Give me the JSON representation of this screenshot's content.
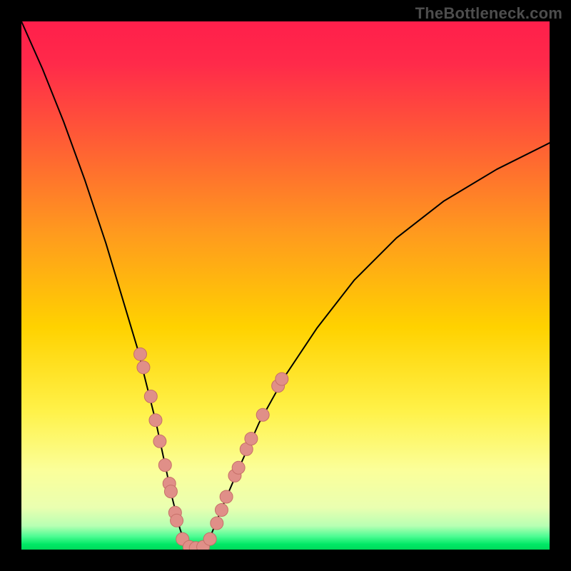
{
  "watermark": "TheBottleneck.com",
  "colors": {
    "bg": "#000000",
    "gradient_top": "#ff1f4b",
    "gradient_mid": "#ffd200",
    "gradient_low": "#fff7a3",
    "gradient_green": "#00e865",
    "curve": "#000000",
    "dot_fill": "#e08f88",
    "dot_stroke": "#c66f68"
  },
  "chart_data": {
    "type": "line",
    "title": "",
    "xlabel": "",
    "ylabel": "",
    "xlim": [
      0,
      100
    ],
    "ylim": [
      0,
      100
    ],
    "series": [
      {
        "name": "bottleneck-curve",
        "x": [
          0,
          4,
          8,
          12,
          16,
          19,
          22,
          24,
          25.5,
          27,
          28.5,
          30,
          31,
          32,
          33,
          34,
          35,
          36,
          38,
          41,
          45,
          50,
          56,
          63,
          71,
          80,
          90,
          100
        ],
        "y": [
          100,
          91,
          81,
          70,
          58,
          48,
          38,
          30,
          24,
          17,
          10,
          4,
          1,
          0,
          0,
          0,
          1,
          3,
          8,
          15,
          24,
          33,
          42,
          51,
          59,
          66,
          72,
          77
        ]
      }
    ],
    "markers": [
      {
        "x": 22.5,
        "y": 37
      },
      {
        "x": 23.1,
        "y": 34.5
      },
      {
        "x": 24.5,
        "y": 29
      },
      {
        "x": 25.4,
        "y": 24.5
      },
      {
        "x": 26.2,
        "y": 20.5
      },
      {
        "x": 27.2,
        "y": 16
      },
      {
        "x": 28.0,
        "y": 12.5
      },
      {
        "x": 28.3,
        "y": 11
      },
      {
        "x": 29.1,
        "y": 7
      },
      {
        "x": 29.4,
        "y": 5.5
      },
      {
        "x": 30.5,
        "y": 2
      },
      {
        "x": 31.8,
        "y": 0.5
      },
      {
        "x": 33.0,
        "y": 0.3
      },
      {
        "x": 34.4,
        "y": 0.5
      },
      {
        "x": 35.7,
        "y": 2
      },
      {
        "x": 37.0,
        "y": 5
      },
      {
        "x": 37.9,
        "y": 7.5
      },
      {
        "x": 38.8,
        "y": 10
      },
      {
        "x": 40.4,
        "y": 14
      },
      {
        "x": 41.1,
        "y": 15.5
      },
      {
        "x": 42.6,
        "y": 19
      },
      {
        "x": 43.5,
        "y": 21
      },
      {
        "x": 45.7,
        "y": 25.5
      },
      {
        "x": 48.6,
        "y": 31
      },
      {
        "x": 49.3,
        "y": 32.3
      }
    ],
    "gradient_stops": [
      {
        "offset": 0.0,
        "color": "#ff1f4b"
      },
      {
        "offset": 0.08,
        "color": "#ff2a4a"
      },
      {
        "offset": 0.22,
        "color": "#ff5a36"
      },
      {
        "offset": 0.4,
        "color": "#ff9a1e"
      },
      {
        "offset": 0.58,
        "color": "#ffd200"
      },
      {
        "offset": 0.74,
        "color": "#fff24a"
      },
      {
        "offset": 0.85,
        "color": "#fbff9a"
      },
      {
        "offset": 0.92,
        "color": "#eaffb0"
      },
      {
        "offset": 0.955,
        "color": "#b8ffb3"
      },
      {
        "offset": 0.975,
        "color": "#4dfc93"
      },
      {
        "offset": 0.99,
        "color": "#00e865"
      },
      {
        "offset": 1.0,
        "color": "#00d85b"
      }
    ]
  }
}
